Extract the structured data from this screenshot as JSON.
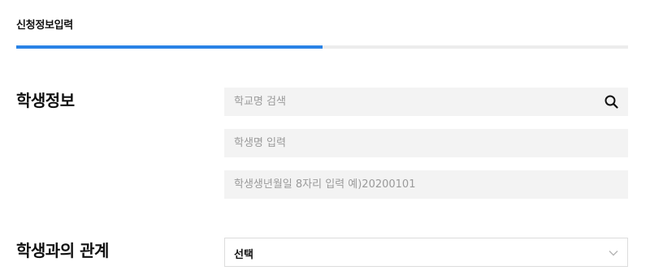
{
  "header": {
    "step_title": "신청정보입력",
    "progress": 0.5
  },
  "student_info": {
    "label": "학생정보",
    "school_search_placeholder": "학교명 검색",
    "student_name_placeholder": "학생명 입력",
    "birthdate_placeholder": "학생생년월일 8자리 입력 예)20200101",
    "search_icon": "search-icon"
  },
  "relation": {
    "label": "학생과의 관계",
    "selected_value": "선택",
    "chevron_icon": "chevron-down-icon"
  },
  "colors": {
    "accent": "#2a83e6",
    "field_bg": "#f3f3f3",
    "track": "#ececec"
  }
}
